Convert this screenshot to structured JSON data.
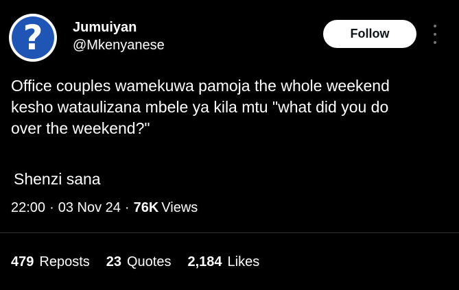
{
  "author": {
    "display_name": "Jumuiyan",
    "handle": "@Mkenyanese",
    "avatar_glyph": "?",
    "avatar_color": "#1f56b5"
  },
  "follow_button": {
    "label": "Follow"
  },
  "more_menu": {
    "icon": "more-vertical-icon"
  },
  "tweet": {
    "text": "Office couples wamekuwa pamoja the whole weekend\nkesho wataulizana mbele ya kila mtu \"what did you do\nover the weekend?\"",
    "text2": "Shenzi sana"
  },
  "meta": {
    "time": "22:00",
    "date": "03 Nov 24",
    "views_count": "76K",
    "views_label": "Views",
    "separator": "·"
  },
  "stats": {
    "reposts_count": "479",
    "reposts_label": "Reposts",
    "quotes_count": "23",
    "quotes_label": "Quotes",
    "likes_count": "2,184",
    "likes_label": "Likes"
  }
}
